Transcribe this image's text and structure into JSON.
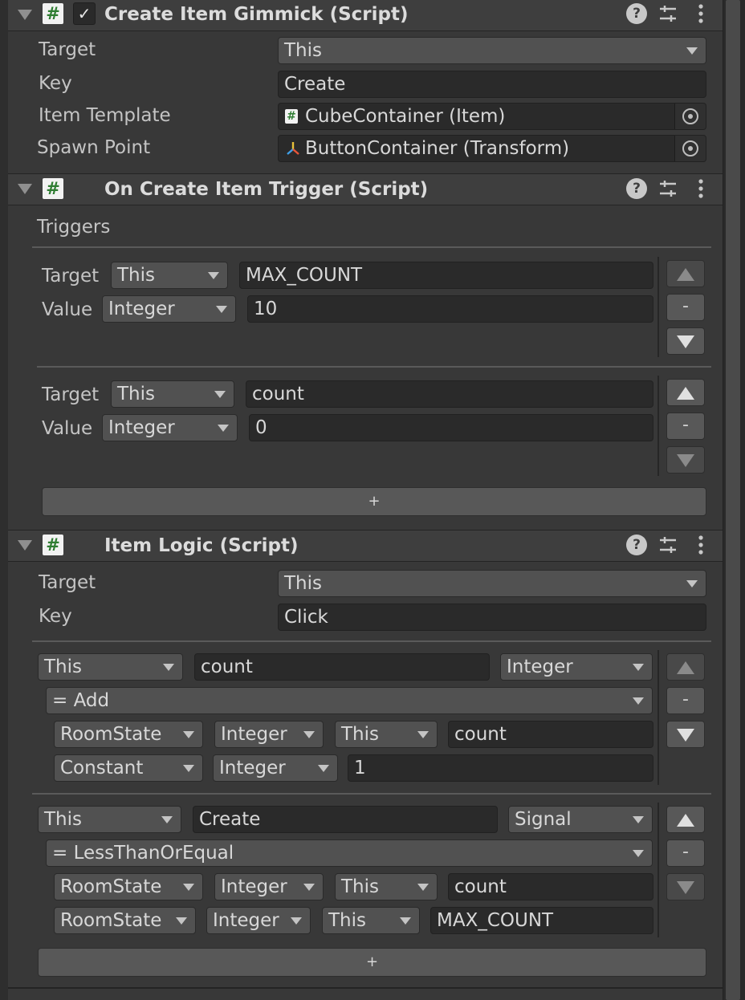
{
  "components": [
    {
      "title": "Create Item Gimmick (Script)",
      "enabled": true,
      "fields": [
        {
          "label": "Target",
          "kind": "dropdown",
          "value": "This"
        },
        {
          "label": "Key",
          "kind": "text",
          "value": "Create"
        },
        {
          "label": "Item Template",
          "kind": "object",
          "value": "CubeContainer (Item)",
          "icon": "script-icon"
        },
        {
          "label": "Spawn Point",
          "kind": "object",
          "value": "ButtonContainer (Transform)",
          "icon": "transform-icon"
        }
      ]
    },
    {
      "title": "On Create Item Trigger (Script)",
      "section_label": "Triggers",
      "triggers": [
        {
          "target_label": "Target",
          "target": "This",
          "key": "MAX_COUNT",
          "value_label": "Value",
          "type": "Integer",
          "value": "10"
        },
        {
          "target_label": "Target",
          "target": "This",
          "key": "count",
          "value_label": "Value",
          "type": "Integer",
          "value": "0"
        }
      ],
      "add_label": "+"
    },
    {
      "title": "Item Logic (Script)",
      "fields": [
        {
          "label": "Target",
          "kind": "dropdown",
          "value": "This"
        },
        {
          "label": "Key",
          "kind": "text",
          "value": "Click"
        }
      ],
      "logics": [
        {
          "target": "This",
          "key": "count",
          "type": "Integer",
          "operator": "= Add",
          "rows": [
            [
              "RoomState",
              "Integer",
              "This",
              "count"
            ],
            [
              "Constant",
              "Integer",
              "1"
            ]
          ]
        },
        {
          "target": "This",
          "key": "Create",
          "type": "Signal",
          "operator": "= LessThanOrEqual",
          "rows": [
            [
              "RoomState",
              "Integer",
              "This",
              "count"
            ],
            [
              "RoomState",
              "Integer",
              "This",
              "MAX_COUNT"
            ]
          ]
        }
      ],
      "add_label": "+"
    }
  ],
  "header_icons": [
    "help-icon",
    "presets-icon",
    "kebab-menu-icon"
  ],
  "list_buttons": {
    "minus": "-"
  },
  "colors": {
    "panel": "#383838",
    "header": "#3e3e3e",
    "field": "#2a2a2a",
    "dropdown": "#515151",
    "script_icon": "#2f7d32"
  }
}
